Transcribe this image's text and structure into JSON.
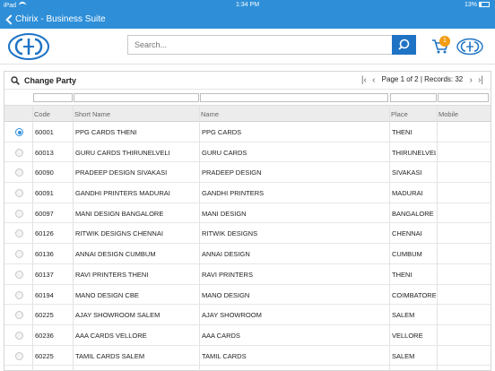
{
  "status": {
    "device": "iPad",
    "time": "1:34 PM",
    "battery": "13%"
  },
  "nav": {
    "title": "Chirix - Business Suite"
  },
  "search": {
    "placeholder": "Search..."
  },
  "cart": {
    "count": "1"
  },
  "panel": {
    "title": "Change Party",
    "pager_text": "Page 1 of 2 | Records: 32",
    "columns": [
      "Code",
      "Short Name",
      "Name",
      "Place",
      "Mobile"
    ]
  },
  "rows": [
    {
      "code": "60001",
      "short_name": "PPG CARDS THENI",
      "name": "PPG CARDS",
      "place": "THENI",
      "mobile": "",
      "selected": true
    },
    {
      "code": "60013",
      "short_name": "GURU CARDS THIRUNELVELI",
      "name": "GURU CARDS",
      "place": "THIRUNELVELI",
      "mobile": "",
      "selected": false
    },
    {
      "code": "60090",
      "short_name": "PRADEEP DESIGN SIVAKASI",
      "name": "PRADEEP DESIGN",
      "place": "SIVAKASI",
      "mobile": "",
      "selected": false
    },
    {
      "code": "60091",
      "short_name": "GANDHI PRINTERS MADURAI",
      "name": "GANDHI PRINTERS",
      "place": "MADURAI",
      "mobile": "",
      "selected": false
    },
    {
      "code": "60097",
      "short_name": "MANI DESIGN BANGALORE",
      "name": "MANI DESIGN",
      "place": "BANGALORE",
      "mobile": "",
      "selected": false
    },
    {
      "code": "60126",
      "short_name": "RITWIK DESIGNS CHENNAI",
      "name": "RITWIK DESIGNS",
      "place": "CHENNAI",
      "mobile": "",
      "selected": false
    },
    {
      "code": "60136",
      "short_name": "ANNAI DESIGN CUMBUM",
      "name": "ANNAI DESIGN",
      "place": "CUMBUM",
      "mobile": "",
      "selected": false
    },
    {
      "code": "60137",
      "short_name": "RAVI PRINTERS THENI",
      "name": "RAVI PRINTERS",
      "place": "THENI",
      "mobile": "",
      "selected": false
    },
    {
      "code": "60194",
      "short_name": "MANO DESIGN CBE",
      "name": "MANO DESIGN",
      "place": "COIMBATORE",
      "mobile": "",
      "selected": false
    },
    {
      "code": "60225",
      "short_name": "AJAY SHOWROOM SALEM",
      "name": "AJAY SHOWROOM",
      "place": "SALEM",
      "mobile": "",
      "selected": false
    },
    {
      "code": "60236",
      "short_name": "AAA CARDS VELLORE",
      "name": "AAA CARDS",
      "place": "VELLORE",
      "mobile": "",
      "selected": false
    },
    {
      "code": "60225",
      "short_name": "TAMIL CARDS SALEM",
      "name": "TAMIL CARDS",
      "place": "SALEM",
      "mobile": "",
      "selected": false
    }
  ],
  "colors": {
    "primary": "#2e8fd8",
    "button": "#1f73c4",
    "badge": "#f39c12"
  },
  "icons": [
    "back-chevron-icon",
    "wifi-icon",
    "battery-icon",
    "company-logo-icon",
    "search-icon",
    "cart-icon",
    "magnifier-icon",
    "first-page-icon",
    "prev-page-icon",
    "next-page-icon",
    "last-page-icon"
  ]
}
